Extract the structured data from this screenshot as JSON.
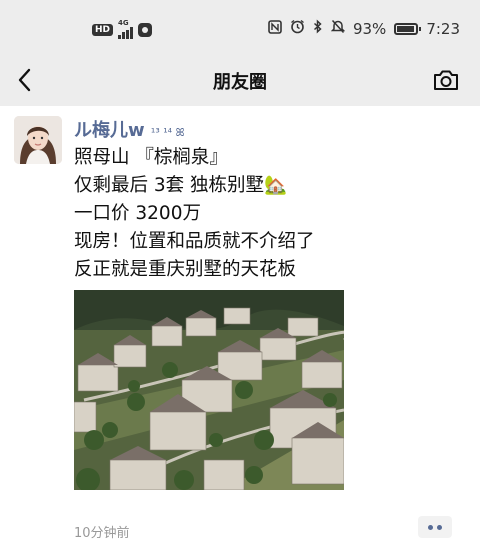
{
  "status_bar": {
    "hd_label": "HD",
    "network_label": "4G",
    "battery_percent": "93%",
    "battery_level": 0.93,
    "time": "7:23",
    "icons": [
      "nfc-icon",
      "alarm-icon",
      "bluetooth-icon",
      "mute-icon"
    ]
  },
  "nav": {
    "title": "朋友圈",
    "back_icon": "chevron-left-icon",
    "camera_icon": "camera-icon"
  },
  "post": {
    "author": "ル梅儿w",
    "author_deco": "¹³ ¹⁴ ꕤ",
    "lines": [
      "照母山 『棕榈泉』",
      "仅剩最后 3套 独栋别墅🏡",
      "一口价 3200万",
      "现房！位置和品质就不介绍了",
      "反正就是重庆别墅的天花板"
    ],
    "image_alt": "aerial view of villas",
    "time": "10分钟前"
  },
  "colors": {
    "link": "#576b95",
    "background": "#ededed"
  }
}
